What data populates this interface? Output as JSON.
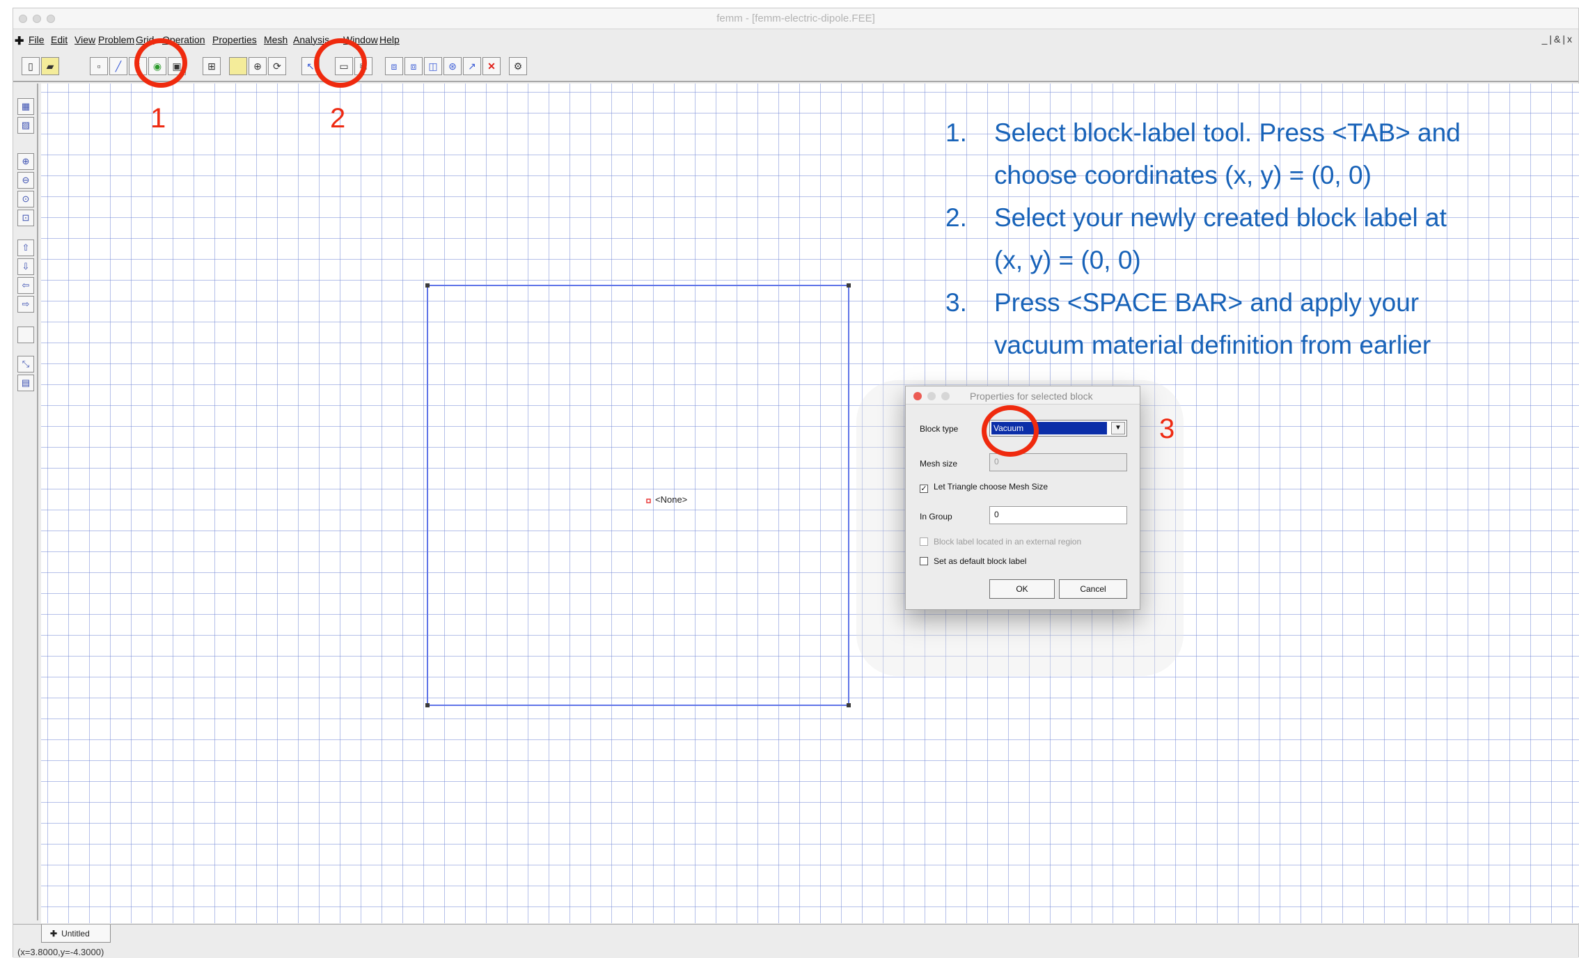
{
  "window": {
    "title": "femm - [femm-electric-dipole.FEE]"
  },
  "menubar": {
    "items": [
      "File",
      "Edit",
      "View",
      "Problem",
      "Grid",
      "Operation",
      "Properties",
      "Mesh",
      "Analysis",
      "Window",
      "Help"
    ],
    "window_controls": "_|&|x"
  },
  "canvas": {
    "node_label": "<None>",
    "square": {
      "x_min": -5,
      "x_max": 5,
      "y_min": -5,
      "y_max": 5
    }
  },
  "tab": {
    "label": "Untitled"
  },
  "status": {
    "coords": "(x=3.8000,y=-4.3000)"
  },
  "annotations": {
    "numbers": [
      "1",
      "2",
      "3"
    ],
    "color": "#ef2a0e"
  },
  "instructions": {
    "color": "#1762b8",
    "items": [
      {
        "num": "1.",
        "lines": [
          "Select block-label tool.  Press <TAB> and",
          "choose coordinates (x, y) = (0, 0)"
        ]
      },
      {
        "num": "2.",
        "lines": [
          "Select your newly created block label at",
          "(x, y) = (0, 0)"
        ]
      },
      {
        "num": "3.",
        "lines": [
          "Press <SPACE BAR> and apply your",
          "vacuum material definition from earlier"
        ]
      }
    ]
  },
  "dialog": {
    "title": "Properties for selected block",
    "block_type_label": "Block type",
    "block_type_value": "Vacuum",
    "mesh_size_label": "Mesh size",
    "mesh_size_value": "0",
    "auto_mesh_label": "Let Triangle choose Mesh Size",
    "auto_mesh_checked": true,
    "in_group_label": "In Group",
    "in_group_value": "0",
    "external_region_label": "Block label located in an external region",
    "default_label": "Set as default block label",
    "ok_label": "OK",
    "cancel_label": "Cancel"
  }
}
